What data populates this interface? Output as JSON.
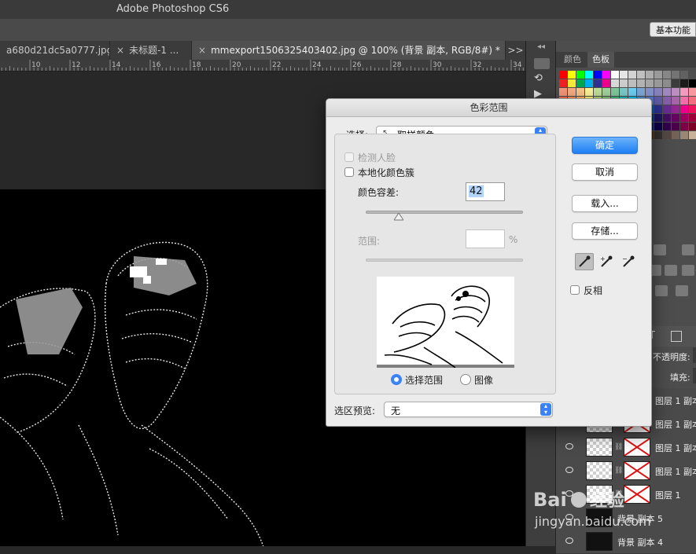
{
  "app": {
    "title": "Adobe Photoshop CS6",
    "workspace": "基本功能"
  },
  "tabs": [
    {
      "label": "a680d21dc5a0777.jpg",
      "close": ""
    },
    {
      "label": "未标题-1 ...",
      "close": "×"
    },
    {
      "label": "mmexport1506325403402.jpg @ 100% (背景 副本, RGB/8#) *",
      "close": "×"
    }
  ],
  "tab_overflow": ">>",
  "ruler": {
    "ticks": [
      "10",
      "12",
      "14",
      "16",
      "18",
      "20",
      "22",
      "24",
      "26",
      "28",
      "30",
      "32",
      "34",
      "36"
    ]
  },
  "panels": {
    "collapse": "◂◂",
    "tabs": [
      "颜色",
      "色板"
    ],
    "active_tab": "色板",
    "layers": {
      "opacity_label": "不透明度:",
      "fill_label": "填充:",
      "rows": [
        "图层 1 副本",
        "图层 1 副本",
        "图层 1 副本",
        "图层 1 副本",
        "图层 1",
        "背景 副本 5",
        "背景 副本 4"
      ]
    }
  },
  "dialog": {
    "title": "色彩范围",
    "select_label": "选择:",
    "select_value": "取样颜色",
    "detect_faces": "检测人脸",
    "localized_clusters": "本地化颜色簇",
    "fuzziness_label": "颜色容差:",
    "fuzziness_value": "42",
    "fuzziness": 42,
    "fuzziness_max": 200,
    "range_label": "范围:",
    "range_value": "",
    "range_unit": "%",
    "mode_selection": "选择范围",
    "mode_image": "图像",
    "preview_label": "选区预览:",
    "preview_value": "无",
    "buttons": {
      "ok": "确定",
      "cancel": "取消",
      "load": "载入...",
      "save": "存储..."
    },
    "invert": "反相"
  },
  "watermark": {
    "brand": "Baidu 经验",
    "url": "jingyan.baidu.com"
  }
}
